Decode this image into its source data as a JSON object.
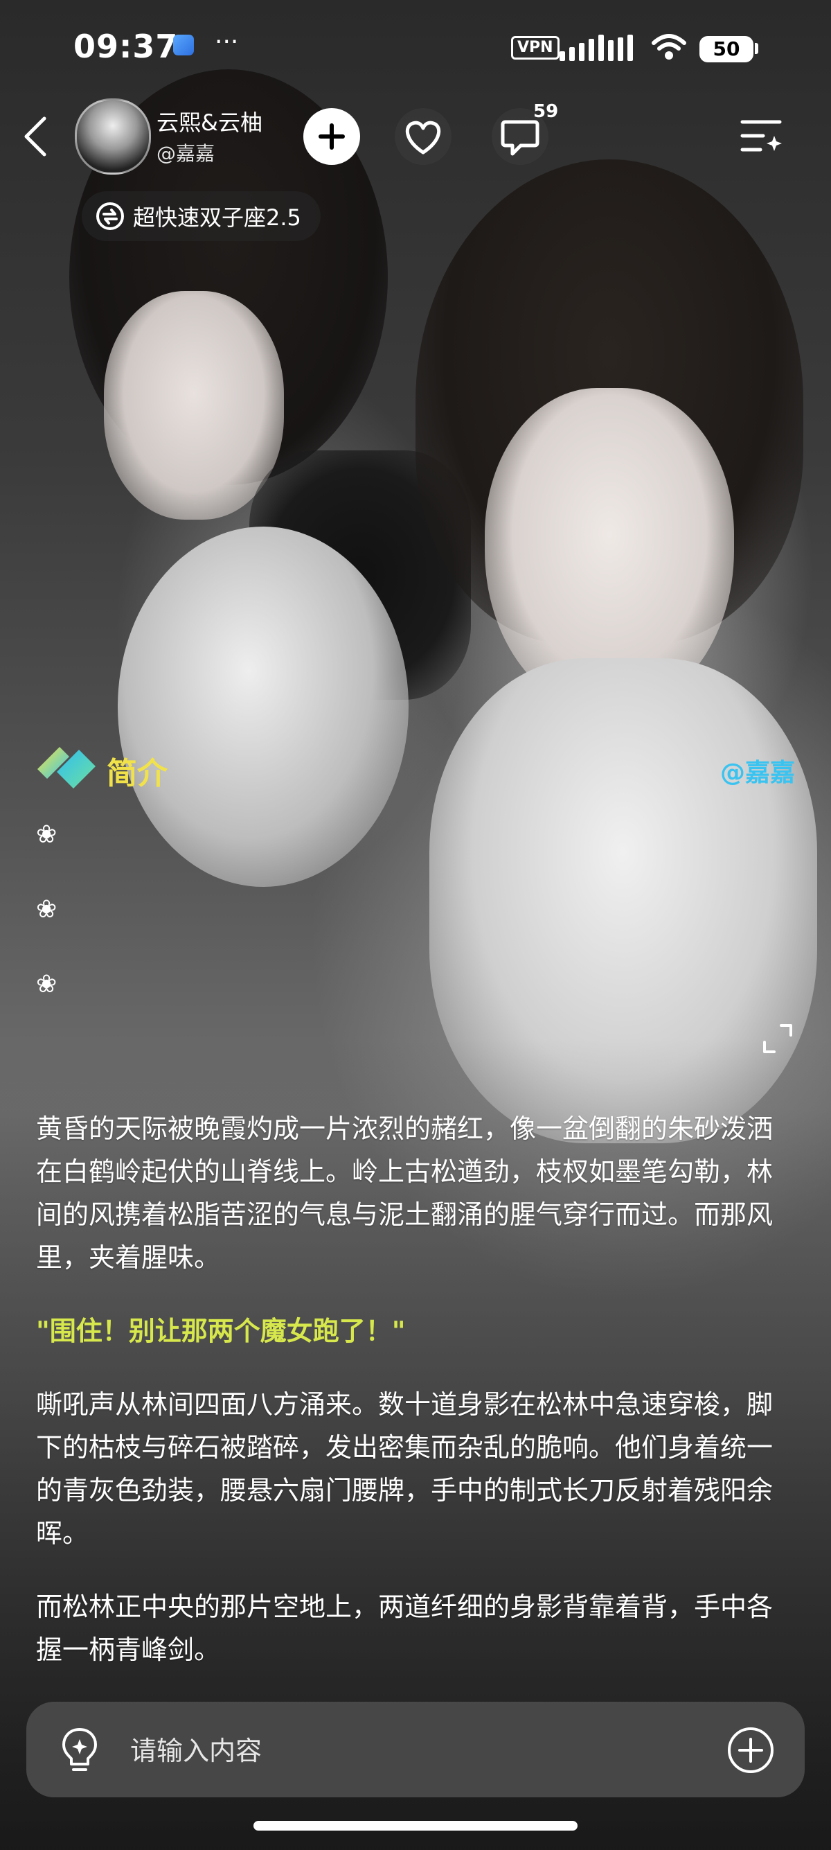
{
  "status_bar": {
    "time": "09:37",
    "more": "···",
    "vpn": "VPN",
    "battery": "50"
  },
  "header": {
    "author_name": "云熙&云柚",
    "author_handle": "@嘉嘉",
    "comment_count": "59",
    "model_label": "超快速双子座2.5"
  },
  "intro": {
    "title": "简介",
    "author": "@嘉嘉",
    "flowers": [
      "❀",
      "❀",
      "❀"
    ]
  },
  "story": {
    "p1": "黄昏的天际被晚霞灼成一片浓烈的赭红，像一盆倒翻的朱砂泼洒在白鹤岭起伏的山脊线上。岭上古松遒劲，枝杈如墨笔勾勒，林间的风携着松脂苦涩的气息与泥土翻涌的腥气穿行而过。而那风里，夹着腥味。",
    "dialog": "\"围住！别让那两个魔女跑了！\"",
    "p2": "嘶吼声从林间四面八方涌来。数十道身影在松林中急速穿梭，脚下的枯枝与碎石被踏碎，发出密集而杂乱的脆响。他们身着统一的青灰色劲装，腰悬六扇门腰牌，手中的制式长刀反射着残阳余晖。",
    "p3": "而松林正中央的那片空地上，两道纤细的身影背靠着背，手中各握一柄青峰剑。"
  },
  "input": {
    "placeholder": "请输入内容"
  },
  "colors": {
    "intro_title": "#f2e24a",
    "intro_author": "#39c3f0",
    "dialog": "#d7e84c",
    "input_bar": "#4b4b4b"
  },
  "icons": {
    "back": "chevron-left-icon",
    "follow": "plus-icon",
    "like": "heart-icon",
    "comment": "speech-bubble-icon",
    "menu": "menu-sparkle-icon",
    "model": "swap-icon",
    "intro_logo": "diamond-logo-icon",
    "expand": "expand-icon",
    "bulb": "lightbulb-icon",
    "add": "plus-circle-icon"
  }
}
